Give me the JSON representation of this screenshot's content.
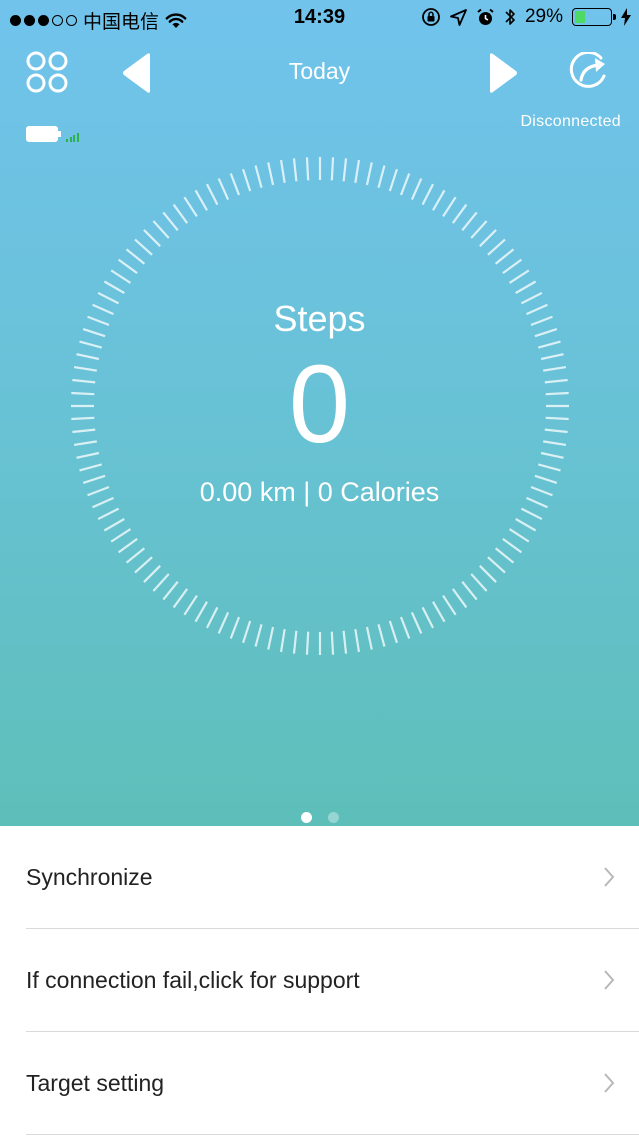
{
  "status_bar": {
    "carrier": "中国电信",
    "time": "14:39",
    "battery_percent": "29%",
    "battery_level": 0.29,
    "signal_filled": 3,
    "signal_total": 5
  },
  "header": {
    "title": "Today",
    "connection_status": "Disconnected"
  },
  "summary": {
    "steps_label": "Steps",
    "steps_value": "0",
    "distance_calories": "0.00 km | 0 Calories"
  },
  "pager": {
    "pages": 2,
    "active": 0
  },
  "menu": {
    "items": [
      {
        "label": "Synchronize"
      },
      {
        "label": "If connection fail,click for support"
      },
      {
        "label": "Target setting"
      }
    ]
  },
  "colors": {
    "gradient_top": "#71c3ec",
    "gradient_bottom": "#5ebfb9",
    "battery_fill": "#4cd964",
    "device_signal": "#2eb34a"
  },
  "icons": {
    "menu": "grid-four-circles-icon",
    "prev": "triangle-left-icon",
    "next": "triangle-right-icon",
    "share": "share-arrow-icon"
  }
}
